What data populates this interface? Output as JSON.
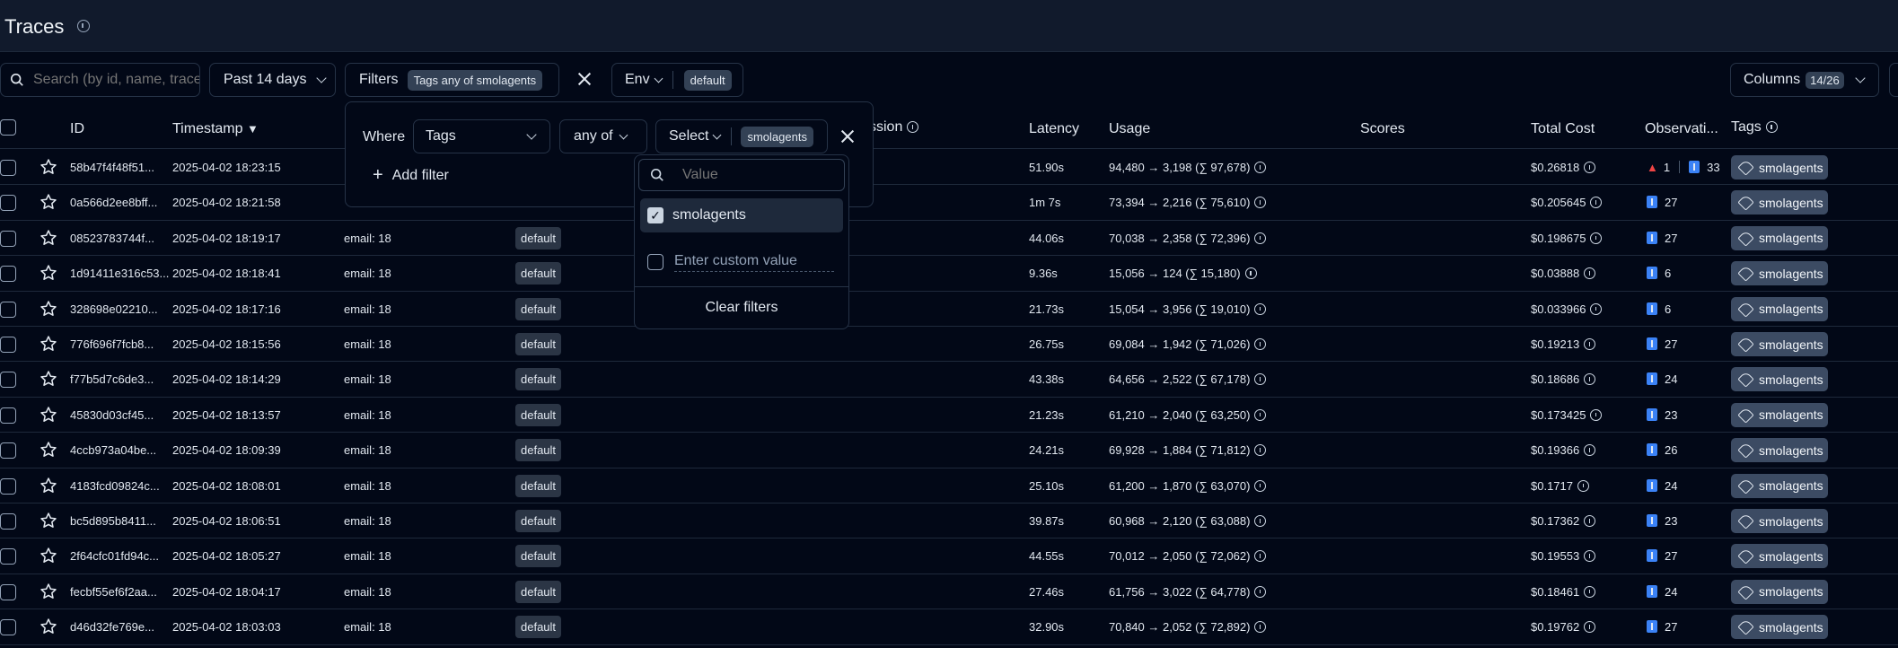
{
  "header": {
    "title": "Traces"
  },
  "toolbar": {
    "search_placeholder": "Search (by id, name, trace",
    "time_range": "Past 14 days",
    "filters_label": "Filters",
    "filters_chip": "Tags any of smolagents",
    "env_label": "Env",
    "env_chip": "default",
    "columns_label": "Columns",
    "columns_count": "14/26"
  },
  "columns": {
    "id": "ID",
    "timestamp": "Timestamp",
    "session": "ssion",
    "latency": "Latency",
    "usage": "Usage",
    "scores": "Scores",
    "total_cost": "Total Cost",
    "observations": "Observati...",
    "tags": "Tags"
  },
  "filter_popover": {
    "where_label": "Where",
    "column_value": "Tags",
    "operator_value": "any of",
    "select_label": "Select",
    "select_chip": "smolagents",
    "add_filter_label": "Add filter"
  },
  "value_dropdown": {
    "search_placeholder": "Value",
    "option_label": "smolagents",
    "custom_placeholder": "Enter custom value",
    "clear_label": "Clear filters"
  },
  "rows": [
    {
      "id": "58b47f4f48f51...",
      "timestamp": "2025-04-02 18:23:15",
      "user": "",
      "env": "",
      "latency": "51.90s",
      "usage": "94,480 → 3,198 (∑ 97,678)",
      "cost": "$0.26818",
      "obs_errors": "1",
      "obs_count": "33",
      "tag": "smolagents"
    },
    {
      "id": "0a566d2ee8bff...",
      "timestamp": "2025-04-02 18:21:58",
      "user": "",
      "env": "",
      "latency": "1m 7s",
      "usage": "73,394 → 2,216 (∑ 75,610)",
      "cost": "$0.205645",
      "obs_errors": "",
      "obs_count": "27",
      "tag": "smolagents"
    },
    {
      "id": "08523783744f...",
      "timestamp": "2025-04-02 18:19:17",
      "user": "email: 18",
      "env": "default",
      "latency": "44.06s",
      "usage": "70,038 → 2,358 (∑ 72,396)",
      "cost": "$0.198675",
      "obs_errors": "",
      "obs_count": "27",
      "tag": "smolagents"
    },
    {
      "id": "1d91411e316c53...",
      "timestamp": "2025-04-02 18:18:41",
      "user": "email: 18",
      "env": "default",
      "latency": "9.36s",
      "usage": "15,056 → 124 (∑ 15,180)",
      "cost": "$0.03888",
      "obs_errors": "",
      "obs_count": "6",
      "tag": "smolagents"
    },
    {
      "id": "328698e02210...",
      "timestamp": "2025-04-02 18:17:16",
      "user": "email: 18",
      "env": "default",
      "latency": "21.73s",
      "usage": "15,054 → 3,956 (∑ 19,010)",
      "cost": "$0.033966",
      "obs_errors": "",
      "obs_count": "6",
      "tag": "smolagents"
    },
    {
      "id": "776f696f7fcb8...",
      "timestamp": "2025-04-02 18:15:56",
      "user": "email: 18",
      "env": "default",
      "latency": "26.75s",
      "usage": "69,084 → 1,942 (∑ 71,026)",
      "cost": "$0.19213",
      "obs_errors": "",
      "obs_count": "27",
      "tag": "smolagents"
    },
    {
      "id": "f77b5d7c6de3...",
      "timestamp": "2025-04-02 18:14:29",
      "user": "email: 18",
      "env": "default",
      "latency": "43.38s",
      "usage": "64,656 → 2,522 (∑ 67,178)",
      "cost": "$0.18686",
      "obs_errors": "",
      "obs_count": "24",
      "tag": "smolagents"
    },
    {
      "id": "45830d03cf45...",
      "timestamp": "2025-04-02 18:13:57",
      "user": "email: 18",
      "env": "default",
      "latency": "21.23s",
      "usage": "61,210 → 2,040 (∑ 63,250)",
      "cost": "$0.173425",
      "obs_errors": "",
      "obs_count": "23",
      "tag": "smolagents"
    },
    {
      "id": "4ccb973a04be...",
      "timestamp": "2025-04-02 18:09:39",
      "user": "email: 18",
      "env": "default",
      "latency": "24.21s",
      "usage": "69,928 → 1,884 (∑ 71,812)",
      "cost": "$0.19366",
      "obs_errors": "",
      "obs_count": "26",
      "tag": "smolagents"
    },
    {
      "id": "4183fcd09824c...",
      "timestamp": "2025-04-02 18:08:01",
      "user": "email: 18",
      "env": "default",
      "latency": "25.10s",
      "usage": "61,200 → 1,870 (∑ 63,070)",
      "cost": "$0.1717",
      "obs_errors": "",
      "obs_count": "24",
      "tag": "smolagents"
    },
    {
      "id": "bc5d895b8411...",
      "timestamp": "2025-04-02 18:06:51",
      "user": "email: 18",
      "env": "default",
      "latency": "39.87s",
      "usage": "60,968 → 2,120 (∑ 63,088)",
      "cost": "$0.17362",
      "obs_errors": "",
      "obs_count": "23",
      "tag": "smolagents"
    },
    {
      "id": "2f64cfc01fd94c...",
      "timestamp": "2025-04-02 18:05:27",
      "user": "email: 18",
      "env": "default",
      "latency": "44.55s",
      "usage": "70,012 → 2,050 (∑ 72,062)",
      "cost": "$0.19553",
      "obs_errors": "",
      "obs_count": "27",
      "tag": "smolagents"
    },
    {
      "id": "fecbf55ef6f2aa...",
      "timestamp": "2025-04-02 18:04:17",
      "user": "email: 18",
      "env": "default",
      "latency": "27.46s",
      "usage": "61,756 → 3,022 (∑ 64,778)",
      "cost": "$0.18461",
      "obs_errors": "",
      "obs_count": "24",
      "tag": "smolagents"
    },
    {
      "id": "d46d32fe769e...",
      "timestamp": "2025-04-02 18:03:03",
      "user": "email: 18",
      "env": "default",
      "latency": "32.90s",
      "usage": "70,840 → 2,052 (∑ 72,892)",
      "cost": "$0.19762",
      "obs_errors": "",
      "obs_count": "27",
      "tag": "smolagents"
    }
  ]
}
